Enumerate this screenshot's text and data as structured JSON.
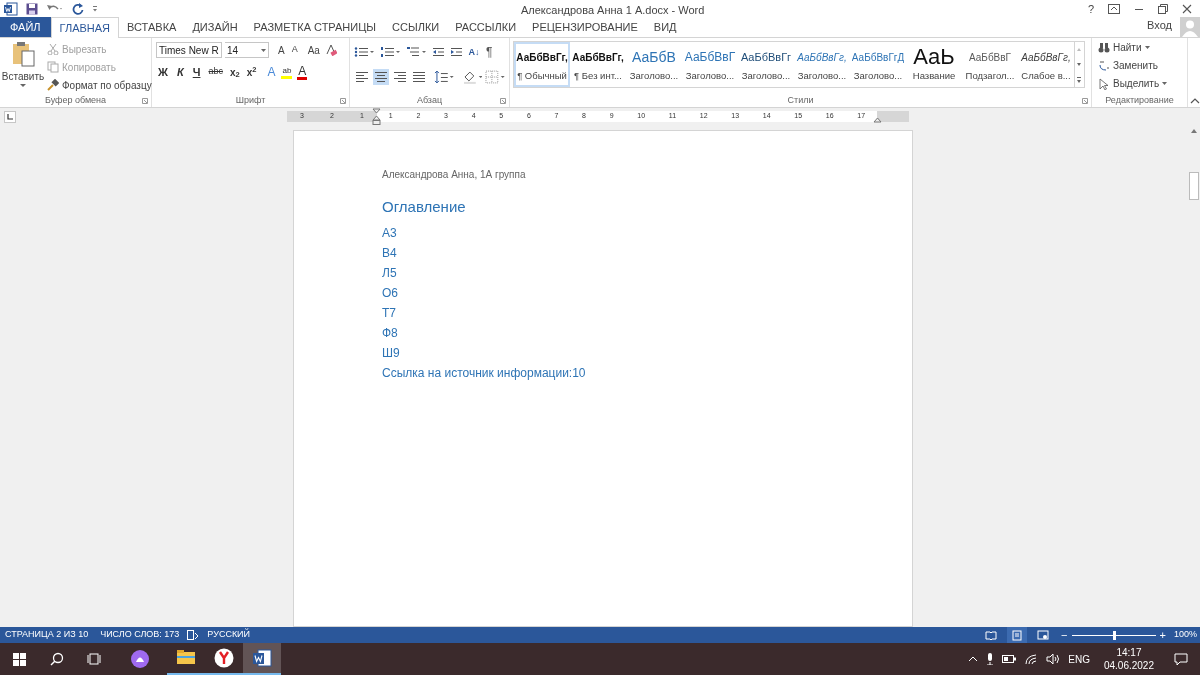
{
  "window": {
    "title": "Александрова Анна 1 А.docx - Word",
    "help": "?",
    "sign_in": "Вход"
  },
  "tabs": [
    {
      "label": "ФАЙЛ",
      "kind": "file",
      "selected": false
    },
    {
      "label": "ГЛАВНАЯ",
      "kind": "tab",
      "selected": true
    },
    {
      "label": "ВСТАВКА",
      "kind": "tab",
      "selected": false
    },
    {
      "label": "ДИЗАЙН",
      "kind": "tab",
      "selected": false
    },
    {
      "label": "РАЗМЕТКА СТРАНИЦЫ",
      "kind": "tab",
      "selected": false
    },
    {
      "label": "ССЫЛКИ",
      "kind": "tab",
      "selected": false
    },
    {
      "label": "РАССЫЛКИ",
      "kind": "tab",
      "selected": false
    },
    {
      "label": "РЕЦЕНЗИРОВАНИЕ",
      "kind": "tab",
      "selected": false
    },
    {
      "label": "ВИД",
      "kind": "tab",
      "selected": false
    }
  ],
  "clipboard": {
    "label": "Буфер обмена",
    "paste": "Вставить",
    "items": [
      {
        "label": "Вырезать",
        "kind": "cut",
        "disabled": true
      },
      {
        "label": "Копировать",
        "kind": "copy",
        "disabled": true
      },
      {
        "label": "Формат по образцу",
        "kind": "painter",
        "disabled": false
      }
    ]
  },
  "font": {
    "label": "Шрифт",
    "name": "Times New R",
    "size": "14",
    "grow": "A",
    "shrink": "A",
    "case": "Aa",
    "bold": "Ж",
    "italic": "К",
    "underline": "Ч",
    "strike": "abc",
    "subscript": "x$_{2}$",
    "superscript": "x$^{2}$",
    "effects": "A",
    "highlight": "ab",
    "color_letter": "A"
  },
  "paragraph": {
    "label": "Абзац",
    "sort": "A↓",
    "marks": "¶",
    "alignments": [
      {
        "kind": "left",
        "selected": false
      },
      {
        "kind": "center",
        "selected": true
      },
      {
        "kind": "right",
        "selected": false
      },
      {
        "kind": "justify",
        "selected": false
      }
    ]
  },
  "styles": {
    "label": "Стили",
    "items": [
      {
        "preview": "АаБбВвГг,",
        "name": "¶ Обычный",
        "kind": "bold",
        "selected": true
      },
      {
        "preview": "АаБбВвГг,",
        "name": "¶ Без инт...",
        "kind": "bold",
        "selected": false
      },
      {
        "preview": "АаБбВ",
        "name": "Заголово...",
        "kind": "h1",
        "selected": false
      },
      {
        "preview": "АаБбВвГ",
        "name": "Заголово...",
        "kind": "h2",
        "selected": false
      },
      {
        "preview": "АаБбВвГг",
        "name": "Заголово...",
        "kind": "h3",
        "selected": false
      },
      {
        "preview": "АаБбВвГг,",
        "name": "Заголово...",
        "kind": "h4",
        "selected": false
      },
      {
        "preview": "АаБбВвГгД",
        "name": "Заголово...",
        "kind": "h5",
        "selected": false
      },
      {
        "preview": "АаЬ",
        "name": "Название",
        "kind": "title",
        "selected": false
      },
      {
        "preview": "АаБбВвГ",
        "name": "Подзагол...",
        "kind": "subtitle",
        "selected": false
      },
      {
        "preview": "АаБбВвГг,",
        "name": "Слабое в...",
        "kind": "emphasis",
        "selected": false
      }
    ]
  },
  "editing": {
    "label": "Редактирование",
    "items": [
      {
        "label": "Найти",
        "kind": "find"
      },
      {
        "label": "Заменить",
        "kind": "replace"
      },
      {
        "label": "Выделить",
        "kind": "select"
      }
    ]
  },
  "ruler": {
    "left_numbers": [
      "3",
      "2",
      "1"
    ],
    "numbers": [
      "1",
      "2",
      "3",
      "4",
      "5",
      "6",
      "7",
      "8",
      "9",
      "10",
      "11",
      "12",
      "13",
      "14",
      "15",
      "16",
      "17"
    ]
  },
  "document": {
    "header": "Александрова Анна, 1А группа",
    "toc_title": "Оглавление",
    "toc": [
      "А3",
      "В4",
      "Л5",
      "О6",
      "Т7",
      "Ф8",
      "Ш9",
      "Ссылка на источник информации:10"
    ]
  },
  "status_bar": {
    "page": "СТРАНИЦА 2 ИЗ 10",
    "words": "ЧИСЛО СЛОВ: 173",
    "language": "РУССКИЙ",
    "views": [
      {
        "kind": "read",
        "selected": false
      },
      {
        "kind": "print",
        "selected": true
      },
      {
        "kind": "web",
        "selected": false
      }
    ],
    "zoom_out": "−",
    "zoom_in": "+",
    "zoom": {
      "level": 0.5
    },
    "zoom_text": "100%"
  },
  "taskbar": {
    "apps": [
      {
        "kind": "explorer",
        "selected": false
      },
      {
        "kind": "yandex",
        "selected": false
      },
      {
        "kind": "word",
        "selected": true
      }
    ],
    "lang": "ENG",
    "time": "14:17",
    "date": "04.06.2022"
  }
}
